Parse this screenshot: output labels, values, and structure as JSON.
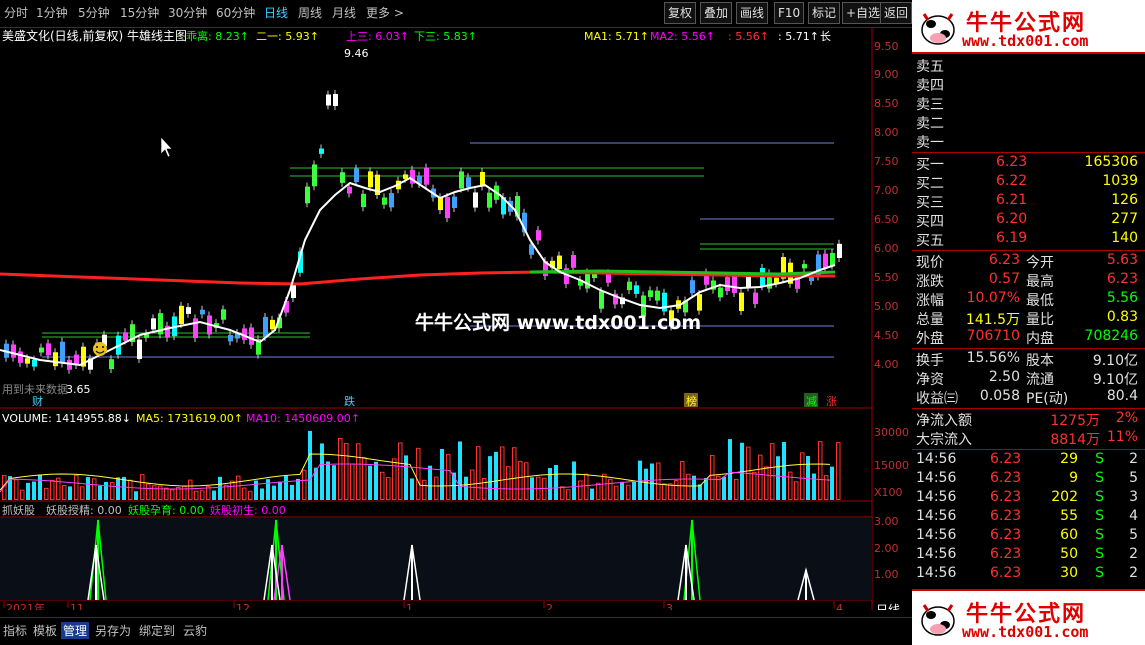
{
  "toolbar": {
    "tabs": [
      "分时",
      "1分钟",
      "5分钟",
      "15分钟",
      "30分钟",
      "60分钟",
      "日线",
      "周线",
      "月线",
      "更多 >"
    ],
    "active_tab": "日线",
    "right_buttons": [
      "复权",
      "叠加",
      "画线",
      "F10",
      "标记",
      "+自选",
      "返回"
    ]
  },
  "chart_header": {
    "title": "美盛文化(日线,前复权) 牛雄线主图",
    "indicators": [
      {
        "label": "乖离: 8.23↑",
        "color": "#00ff00"
      },
      {
        "label": "二一: 5.93↑",
        "color": "#ffff00"
      },
      {
        "label": "上三: 6.03↑",
        "color": "#ff00ff"
      },
      {
        "label": "下三: 5.83↑",
        "color": "#00ff00"
      },
      {
        "label": "MA1: 5.71↑",
        "color": "#ffff00"
      },
      {
        "label": "MA2: 5.56↑",
        "color": "#ff00ff"
      },
      {
        "label": ": 5.56↑",
        "color": "#ff3030"
      },
      {
        "label": ": 5.71↑",
        "color": "#ffffff"
      },
      {
        "label": "长",
        "color": "#ffffff"
      }
    ]
  },
  "price_axis": [
    "9.50",
    "9.00",
    "8.50",
    "8.00",
    "7.50",
    "7.00",
    "6.50",
    "6.00",
    "5.50",
    "5.00",
    "4.50",
    "4.00"
  ],
  "price_annotations": {
    "high": "9.46",
    "low": "3.65",
    "note": "用到未来数据"
  },
  "event_markers": [
    "财",
    "跌",
    "榜",
    "减",
    "涨"
  ],
  "volume_header": [
    {
      "label": "VOLUME: 1414955.88↓",
      "color": "#ffffff"
    },
    {
      "label": "MA5: 1731619.00↑",
      "color": "#ffff00"
    },
    {
      "label": "MA10: 1450609.00↑",
      "color": "#ff00ff"
    }
  ],
  "volume_axis": [
    "30000",
    "15000",
    "X100"
  ],
  "sub_header": [
    {
      "label": "抓妖股",
      "color": "#c0c0c0"
    },
    {
      "label": "妖股授精: 0.00",
      "color": "#c0c0c0"
    },
    {
      "label": "妖股孕育: 0.00",
      "color": "#00ff00"
    },
    {
      "label": "妖股初生: 0.00",
      "color": "#ff00ff"
    }
  ],
  "sub_axis": [
    "3.00",
    "2.00",
    "1.00"
  ],
  "date_axis": [
    "2021年",
    "11",
    "12",
    "1",
    "2",
    "3",
    "4"
  ],
  "period_label": "日线",
  "bottom_tabs": [
    "指标",
    "模板",
    "管理",
    "另存为",
    "绑定到",
    "云豹"
  ],
  "bottom_active": "管理",
  "watermark": "牛牛公式网 www.tdx001.com",
  "logo": {
    "title": "牛牛公式网",
    "url": "www.tdx001.com"
  },
  "order_book": {
    "sells": [
      {
        "label": "卖五",
        "price": "",
        "vol": ""
      },
      {
        "label": "卖四",
        "price": "",
        "vol": ""
      },
      {
        "label": "卖三",
        "price": "",
        "vol": ""
      },
      {
        "label": "卖二",
        "price": "",
        "vol": ""
      },
      {
        "label": "卖一",
        "price": "",
        "vol": ""
      }
    ],
    "buys": [
      {
        "label": "买一",
        "price": "6.23",
        "vol": "165306"
      },
      {
        "label": "买二",
        "price": "6.22",
        "vol": "1039"
      },
      {
        "label": "买三",
        "price": "6.21",
        "vol": "126"
      },
      {
        "label": "买四",
        "price": "6.20",
        "vol": "277"
      },
      {
        "label": "买五",
        "price": "6.19",
        "vol": "140"
      }
    ]
  },
  "stats": [
    {
      "l1": "现价",
      "v1": "6.23",
      "c1": "#ff3030",
      "l2": "今开",
      "v2": "5.63",
      "c2": "#ff3030"
    },
    {
      "l1": "涨跌",
      "v1": "0.57",
      "c1": "#ff3030",
      "l2": "最高",
      "v2": "6.23",
      "c2": "#ff3030"
    },
    {
      "l1": "涨幅",
      "v1": "10.07%",
      "c1": "#ff3030",
      "l2": "最低",
      "v2": "5.56",
      "c2": "#00ff00"
    },
    {
      "l1": "总量",
      "v1": "141.5万",
      "c1": "#ffff00",
      "l2": "量比",
      "v2": "0.83",
      "c2": "#ffff00"
    },
    {
      "l1": "外盘",
      "v1": "706710",
      "c1": "#ff3030",
      "l2": "内盘",
      "v2": "708246",
      "c2": "#00ff00"
    }
  ],
  "stats2": [
    {
      "l1": "换手",
      "v1": "15.56%",
      "l2": "股本",
      "v2": "9.10亿"
    },
    {
      "l1": "净资",
      "v1": "2.50",
      "l2": "流通",
      "v2": "9.10亿"
    },
    {
      "l1": "收益㈢",
      "v1": "0.058",
      "l2": "PE(动)",
      "v2": "80.4"
    }
  ],
  "flows": [
    {
      "label": "净流入额",
      "value": "1275万",
      "pct": "2%"
    },
    {
      "label": "大宗流入",
      "value": "8814万",
      "pct": "11%"
    }
  ],
  "ticks": [
    {
      "time": "14:56",
      "price": "6.23",
      "vol": "29",
      "side": "S"
    },
    {
      "time": "14:56",
      "price": "6.23",
      "vol": "9",
      "side": "S"
    },
    {
      "time": "14:56",
      "price": "6.23",
      "vol": "202",
      "side": "S"
    },
    {
      "time": "14:56",
      "price": "6.23",
      "vol": "55",
      "side": "S"
    },
    {
      "time": "14:56",
      "price": "6.23",
      "vol": "60",
      "side": "S"
    },
    {
      "time": "14:56",
      "price": "6.23",
      "vol": "50",
      "side": "S"
    },
    {
      "time": "14:56",
      "price": "6.23",
      "vol": "30",
      "side": "S"
    },
    {
      "time": "14:56",
      "price": "6.23",
      "vol": "30",
      "side": "S"
    }
  ],
  "tick_vol_colors": [
    "#ffff00",
    "#ffff00",
    "#ffff00",
    "#ffff00",
    "#ffff00",
    "#ffff00",
    "#ffff00",
    "#ffff00"
  ],
  "tick_side_extra": [
    "2",
    "5",
    "3",
    "4",
    "5",
    "2",
    "2",
    "3"
  ]
}
